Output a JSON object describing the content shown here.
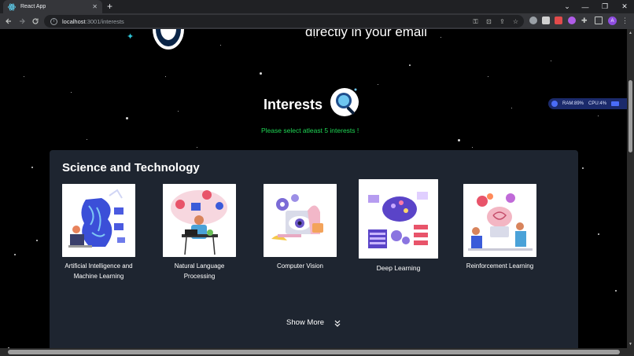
{
  "browser": {
    "tab_title": "React App",
    "tab_close": "✕",
    "new_tab": "+",
    "url_host": "localhost",
    "url_path": ":3001/interests",
    "window_controls": [
      "⌄",
      "—",
      "❐",
      "✕"
    ],
    "profile_initial": "A"
  },
  "page": {
    "hero_text": "directly in your email",
    "interests_title": "Interests",
    "hint": "Please select atleast 5 interests !",
    "category_title": "Science and Technology",
    "show_more": "Show More",
    "cards": [
      {
        "label_line1": "Artificial Intelligence and",
        "label_line2": "Machine Learning",
        "icon": "ai-brain-illustration"
      },
      {
        "label_line1": "Natural Language",
        "label_line2": "Processing",
        "icon": "nlp-illustration"
      },
      {
        "label_line1": "Computer Vision",
        "label_line2": "",
        "icon": "computer-vision-illustration"
      },
      {
        "label_line1": "Deep Learning",
        "label_line2": "",
        "icon": "deep-learning-illustration"
      },
      {
        "label_line1": "Reinforcement Learning",
        "label_line2": "",
        "icon": "reinforcement-learning-illustration"
      }
    ]
  },
  "system_monitor": {
    "ram": "RAM:89%",
    "cpu": "CPU:4%"
  },
  "colors": {
    "hint_green": "#1fd655",
    "panel_bg": "#1e2530",
    "page_bg": "#000000"
  }
}
